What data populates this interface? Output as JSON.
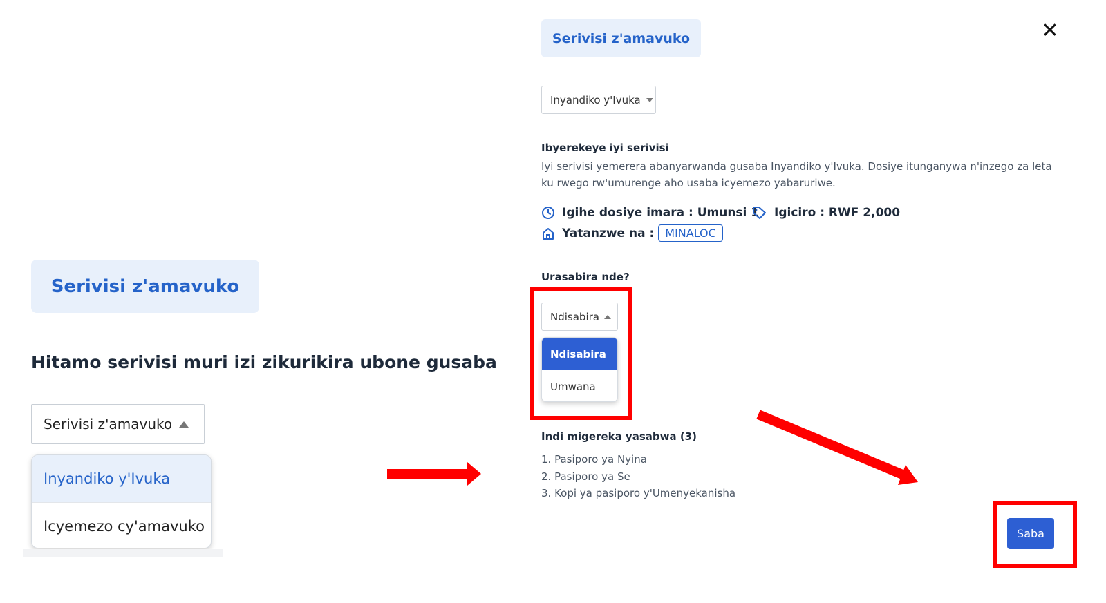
{
  "left": {
    "badge": "Serivisi z'amavuko",
    "heading": "Hitamo serivisi muri izi zikurikira ubone gusaba",
    "select_value": "Serivisi z'amavuko",
    "options": [
      "Inyandiko y'Ivuka",
      "Icyemezo cy'amavuko"
    ]
  },
  "right": {
    "badge": "Serivisi z'amavuko",
    "service_select": "Inyandiko y'Ivuka",
    "desc_title": "Ibyerekeye iyi serivisi",
    "desc_text": "Iyi serivisi yemerera abanyarwanda gusaba Inyandiko y'Ivuka. Dosiye itunganywa n'inzego za leta ku rwego rw'umurenge aho usaba icyemezo yabaruriwe.",
    "duration": "Igihe dosiye imara : Umunsi 1",
    "price": "Igiciro : RWF 2,000",
    "provider_label": "Yatanzwe na :",
    "provider": "MINALOC",
    "question": "Urasabira nde?",
    "applicant_select": "Ndisabira",
    "applicant_options": [
      "Ndisabira",
      "Umwana"
    ],
    "requirements_title": "Indi migereka yasabwa (3)",
    "requirements": [
      "1. Pasiporo ya Nyina",
      "2. Pasiporo ya Se",
      "3. Kopi ya pasiporo y'Umenyekanisha"
    ],
    "submit_label": "Saba",
    "close_symbol": "✕"
  },
  "colors": {
    "accent": "#2563c9",
    "button": "#2d5fd3",
    "highlight": "#ff0000",
    "badge_bg": "#e8f0fb"
  },
  "icons": [
    "clock-icon",
    "tag-icon",
    "home-icon",
    "close-icon",
    "caret-up-icon",
    "caret-down-icon",
    "arrow-right-icon",
    "arrow-diagonal-icon"
  ]
}
